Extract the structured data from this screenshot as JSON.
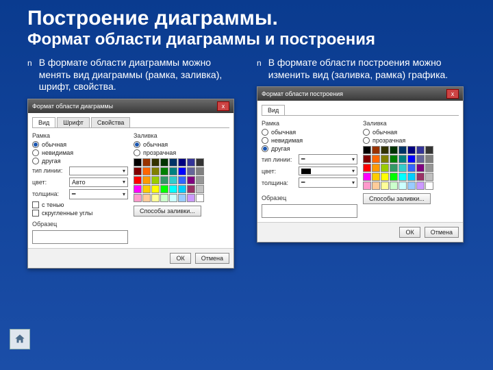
{
  "title": "Построение диаграммы.",
  "subtitle": "Формат области диаграммы и построения",
  "bullet_marker": "n",
  "left_bullet": "В формате области диаграммы можно менять вид диаграммы (рамка, заливка), шрифт, свойства.",
  "right_bullet": "В формате области построения можно изменить вид (заливка, рамка) графика.",
  "dialog1": {
    "title": "Формат области диаграммы",
    "close": "x",
    "tabs": [
      "Вид",
      "Шрифт",
      "Свойства"
    ],
    "frame_group": "Рамка",
    "frame_opts": [
      "обычная",
      "невидимая",
      "другая"
    ],
    "line_type_lbl": "тип линии:",
    "color_lbl": "цвет:",
    "color_val": "Авто",
    "weight_lbl": "толщина:",
    "shadow": "с тенью",
    "rounded": "скругленные углы",
    "fill_group": "Заливка",
    "fill_opts": [
      "обычная",
      "прозрачная"
    ],
    "fill_effects": "Способы заливки...",
    "sample_lbl": "Образец",
    "ok": "ОК",
    "cancel": "Отмена"
  },
  "dialog2": {
    "title": "Формат области построения",
    "close": "x",
    "tabs": [
      "Вид"
    ],
    "frame_group": "Рамка",
    "frame_opts": [
      "обычная",
      "невидимая",
      "другая"
    ],
    "line_type_lbl": "тип линии:",
    "color_lbl": "цвет:",
    "weight_lbl": "толщина:",
    "fill_group": "Заливка",
    "fill_opts": [
      "обычная",
      "прозрачная"
    ],
    "fill_effects": "Способы заливки...",
    "sample_lbl": "Образец",
    "ok": "ОК",
    "cancel": "Отмена"
  },
  "palette": [
    "#000000",
    "#993300",
    "#333300",
    "#003300",
    "#003366",
    "#000080",
    "#333399",
    "#333333",
    "#800000",
    "#ff6600",
    "#808000",
    "#008000",
    "#008080",
    "#0000ff",
    "#666699",
    "#808080",
    "#ff0000",
    "#ff9900",
    "#99cc00",
    "#339966",
    "#33cccc",
    "#3366ff",
    "#800080",
    "#969696",
    "#ff00ff",
    "#ffcc00",
    "#ffff00",
    "#00ff00",
    "#00ffff",
    "#00ccff",
    "#993366",
    "#c0c0c0",
    "#ff99cc",
    "#ffcc99",
    "#ffff99",
    "#ccffcc",
    "#ccffff",
    "#99ccff",
    "#cc99ff",
    "#ffffff"
  ]
}
